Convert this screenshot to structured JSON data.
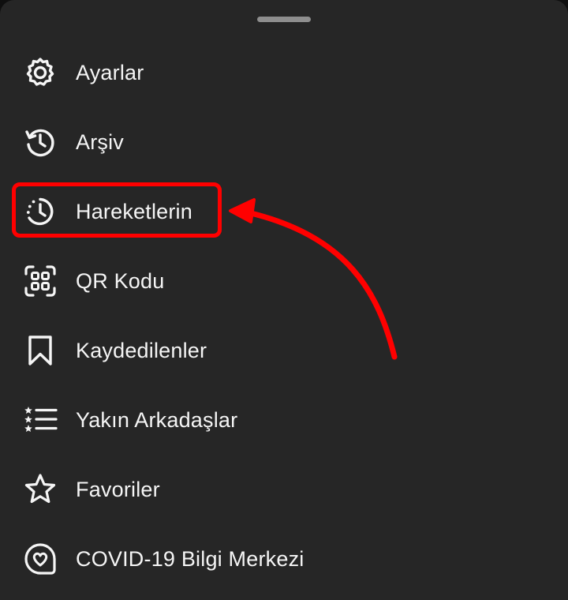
{
  "menu": {
    "items": [
      {
        "label": "Ayarlar",
        "icon": "settings-gear-icon"
      },
      {
        "label": "Arşiv",
        "icon": "archive-history-icon"
      },
      {
        "label": "Hareketlerin",
        "icon": "activity-clock-icon"
      },
      {
        "label": "QR Kodu",
        "icon": "qr-code-icon"
      },
      {
        "label": "Kaydedilenler",
        "icon": "bookmark-icon"
      },
      {
        "label": "Yakın Arkadaşlar",
        "icon": "close-friends-list-icon"
      },
      {
        "label": "Favoriler",
        "icon": "star-icon"
      },
      {
        "label": "COVID-19 Bilgi Merkezi",
        "icon": "covid-heart-icon"
      }
    ]
  },
  "colors": {
    "sheet_background": "#262626",
    "text": "#f5f5f5",
    "handle": "#8e8e8e",
    "annotation": "#ff0000"
  },
  "annotation": {
    "highlighted_item": "Hareketlerin"
  }
}
